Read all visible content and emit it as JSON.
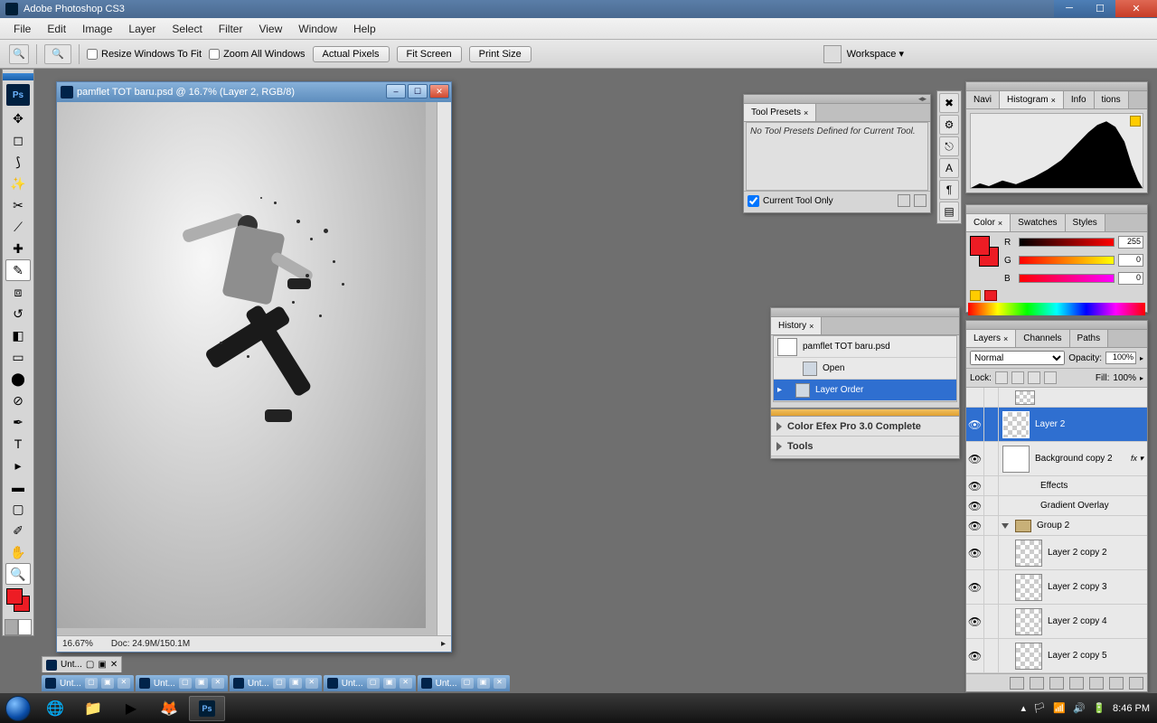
{
  "app": {
    "title": "Adobe Photoshop CS3"
  },
  "menus": [
    "File",
    "Edit",
    "Image",
    "Layer",
    "Select",
    "Filter",
    "View",
    "Window",
    "Help"
  ],
  "options": {
    "resize_label": "Resize Windows To Fit",
    "zoom_all_label": "Zoom All Windows",
    "actual_pixels": "Actual Pixels",
    "fit_screen": "Fit Screen",
    "print_size": "Print Size",
    "workspace": "Workspace ▾"
  },
  "document": {
    "title": "pamflet TOT baru.psd @ 16.7% (Layer 2, RGB/8)",
    "zoom": "16.67%",
    "docsize": "Doc: 24.9M/150.1M"
  },
  "tool_presets": {
    "tab": "Tool Presets",
    "empty": "No Tool Presets Defined for Current Tool.",
    "current_only": "Current Tool Only"
  },
  "nav_tabs": [
    "Navi",
    "Histogram",
    "Info",
    "tions"
  ],
  "color": {
    "tabs": [
      "Color",
      "Swatches",
      "Styles"
    ],
    "r_label": "R",
    "g_label": "G",
    "b_label": "B",
    "r_val": "255",
    "g_val": "0",
    "b_val": "0"
  },
  "history": {
    "tab": "History",
    "doc": "pamflet TOT baru.psd",
    "items": [
      "Open",
      "Layer Order"
    ]
  },
  "plugins": {
    "row1": "Color Efex Pro 3.0 Complete",
    "row2": "Tools"
  },
  "layers": {
    "tabs": [
      "Layers",
      "Channels",
      "Paths"
    ],
    "blend": "Normal",
    "opacity_label": "Opacity:",
    "opacity_val": "100%",
    "lock_label": "Lock:",
    "fill_label": "Fill:",
    "fill_val": "100%",
    "items": [
      {
        "name": "Layer 2",
        "sel": true
      },
      {
        "name": "Background copy 2",
        "fx": true
      },
      {
        "name": "Effects",
        "sub": true
      },
      {
        "name": "Gradient Overlay",
        "sub": true
      },
      {
        "name": "Group 2",
        "group": true
      },
      {
        "name": "Layer 2 copy 2"
      },
      {
        "name": "Layer 2 copy 3"
      },
      {
        "name": "Layer 2 copy 4"
      },
      {
        "name": "Layer 2 copy 5"
      }
    ]
  },
  "doctabs": [
    "Unt...",
    "Unt...",
    "Unt...",
    "Unt...",
    "Unt..."
  ],
  "minitab": "Unt...",
  "taskbar": {
    "time": "8:46 PM"
  }
}
